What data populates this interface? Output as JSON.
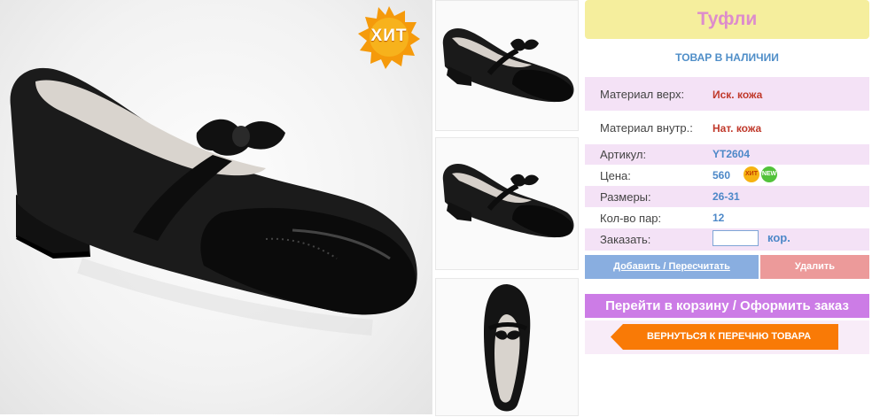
{
  "gallery": {
    "hit_badge": "ХИТ",
    "main_icon": "shoe-side-photo",
    "thumb_icons": [
      "shoe-side-photo",
      "shoe-side-photo",
      "shoe-top-photo"
    ]
  },
  "product": {
    "title": "Туфли",
    "stock": "ТОВАР В НАЛИЧИИ",
    "specs": [
      {
        "label": "Материал верх:",
        "value": "Иск. кожа"
      },
      {
        "label": "Материал внутр.:",
        "value": "Нат. кожа"
      },
      {
        "label": "Артикул:",
        "value": "YT2604"
      },
      {
        "label": "Цена:",
        "value": "560"
      },
      {
        "label": "Размеры:",
        "value": "26-31"
      },
      {
        "label": "Кол-во пар:",
        "value": "12"
      }
    ],
    "price_badges": [
      "ХИТ",
      "NEW"
    ],
    "order": {
      "label": "Заказать:",
      "value": "",
      "unit": "кор."
    }
  },
  "actions": {
    "add_label": "Добавить / Пересчитать",
    "delete_label": "Удалить",
    "cart_label": "Перейти в корзину / Оформить заказ",
    "back_label": "ВЕРНУТЬСЯ К ПЕРЕЧНЮ ТОВАРА"
  },
  "colors": {
    "title_bg": "#f5ee9d",
    "title_text": "#dd8ccc",
    "row_pink": "#f4e2f6",
    "value_red": "#c0392b",
    "value_blue": "#4d88c8",
    "add_button": "#89aee0",
    "delete_button": "#ec9a9a",
    "cart_button": "#cc7ce6",
    "back_button": "#f97a06"
  }
}
